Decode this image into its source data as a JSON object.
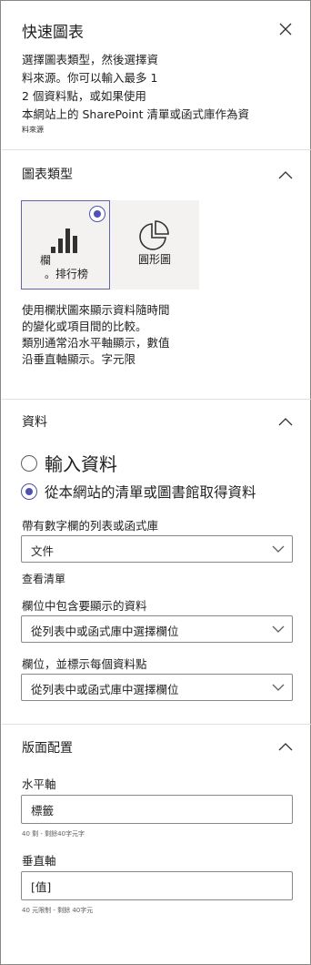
{
  "header": {
    "title": "快速圖表",
    "close_icon": "close-icon"
  },
  "description": {
    "lines": [
      "選擇圖表類型，然後選擇資",
      "料來源。你可以輸入最多 1",
      "2 個資料點，或如果使用",
      "本網站上的 SharePoint 清單或函式庫作為資",
      "料來源"
    ]
  },
  "chart_type": {
    "title": "圖表類型",
    "options": [
      {
        "label_line1": "欄",
        "label_line2": "。排行榜",
        "icon": "bar-chart-icon",
        "selected": true
      },
      {
        "label": "圓形圖",
        "icon": "pie-chart-icon",
        "selected": false
      }
    ],
    "description_lines": [
      "使用欄狀圖來顯示資料隨時間",
      "的變化或項目間的比較。",
      "類別通常沿水平軸顯示，數值",
      "沿垂直軸顯示。字元限"
    ]
  },
  "data": {
    "title": "資料",
    "radio_enter": "輸入資料",
    "radio_from_list": "從本網站的清單或圖書館取得資料",
    "list_label": "帶有數字欄的列表或函式庫",
    "list_value": "文件",
    "view_list_link": "查看清單",
    "column_label": "欄位中包含要顯示的資料",
    "column_value": "從列表中或函式庫中選擇欄位",
    "label_column_label": "欄位，並標示每個資料點",
    "label_column_value": "從列表中或函式庫中選擇欄位"
  },
  "layout": {
    "title": "版面配置",
    "x_axis_label": "水平軸",
    "x_axis_value": "標籤",
    "x_axis_hint": "40 剩 - 剩餘40字元字",
    "y_axis_label": "垂直軸",
    "y_axis_value": "[值]",
    "y_axis_hint": "40 元限制 - 剩餘 40字元"
  },
  "colors": {
    "accent": "#4f52b2",
    "tile_bg": "#f3f2f1",
    "border": "#8a8886",
    "divider": "#e1dfdd"
  }
}
